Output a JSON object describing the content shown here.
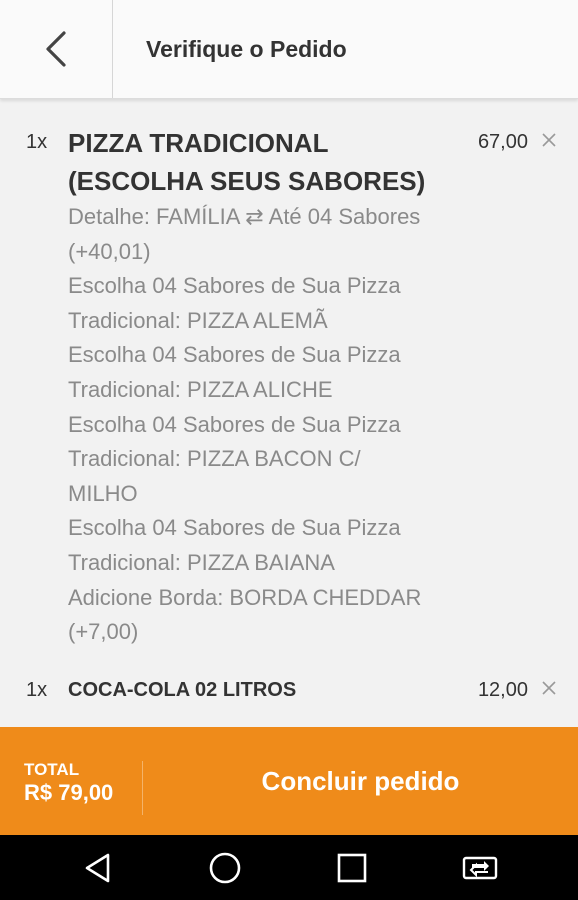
{
  "header": {
    "title": "Verifique o Pedido",
    "back_icon": "chevron-left-icon"
  },
  "items": [
    {
      "qty": "1x",
      "title_lines": [
        "PIZZA TRADICIONAL",
        "(ESCOLHA SEUS SABORES)"
      ],
      "price": "67,00",
      "details": [
        "Detalhe: FAMÍLIA ⇄ Até 04 Sabores",
        "(+40,01)",
        "Escolha 04 Sabores de Sua Pizza",
        "Tradicional: PIZZA ALEMÃ",
        "Escolha 04 Sabores de Sua Pizza",
        "Tradicional: PIZZA ALICHE",
        "Escolha 04 Sabores de Sua Pizza",
        "Tradicional: PIZZA BACON C/",
        "MILHO",
        "Escolha 04 Sabores de Sua Pizza",
        "Tradicional: PIZZA BAIANA",
        "Adicione Borda: BORDA CHEDDAR",
        "(+7,00)"
      ]
    },
    {
      "qty": "1x",
      "title": "COCA-COLA 02 LITROS",
      "price": "12,00"
    }
  ],
  "footer": {
    "total_label": "TOTAL",
    "total_value": "R$ 79,00",
    "conclude_label": "Concluir pedido",
    "accent_color": "#ef8b1a"
  },
  "navbar": {
    "icons": [
      "back-triangle-icon",
      "home-circle-icon",
      "recents-square-icon",
      "screen-rotate-icon"
    ]
  }
}
